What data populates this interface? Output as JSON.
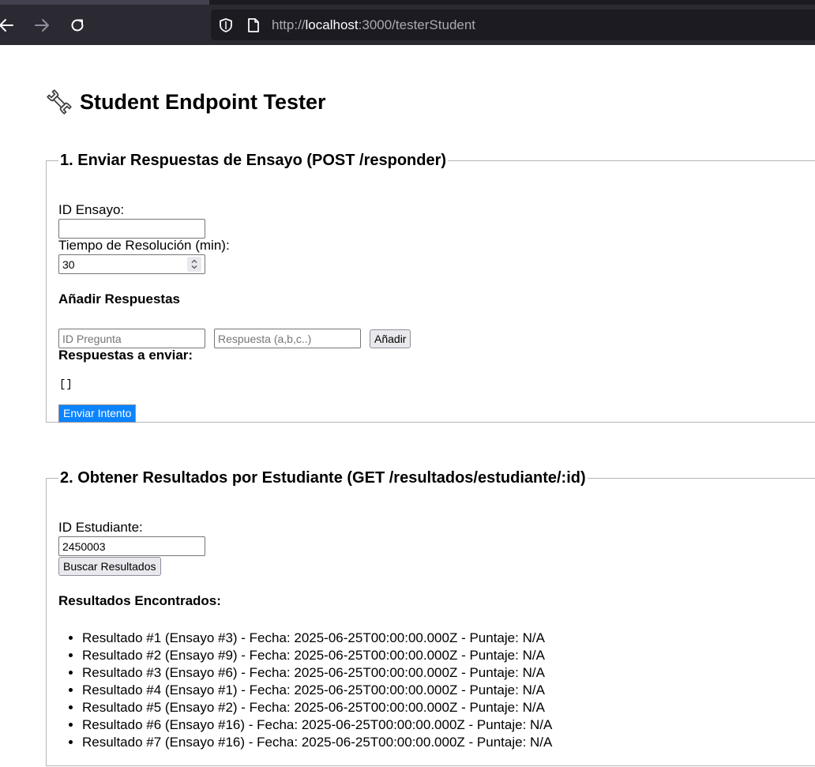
{
  "browser": {
    "url_scheme": "http://",
    "url_host": "localhost",
    "url_rest": ":3000/testerStudent"
  },
  "page": {
    "title": "Student Endpoint Tester"
  },
  "section1": {
    "legend": "1. Enviar Respuestas de Ensayo (POST /responder)",
    "id_ensayo_label": "ID Ensayo:",
    "id_ensayo_value": "",
    "tiempo_label": "Tiempo de Resolución (min):",
    "tiempo_value": "30",
    "add_answers_heading": "Añadir Respuestas",
    "pregunta_placeholder": "ID Pregunta",
    "respuesta_placeholder": "Respuesta (a,b,c..)",
    "add_button": "Añadir",
    "to_send_heading": "Respuestas a enviar:",
    "to_send_json": "[]",
    "submit_button": "Enviar Intento"
  },
  "section2": {
    "legend": "2. Obtener Resultados por Estudiante (GET /resultados/estudiante/:id)",
    "id_estudiante_label": "ID Estudiante:",
    "id_estudiante_value": "2450003",
    "search_button": "Buscar Resultados",
    "results_heading": "Resultados Encontrados:",
    "results": [
      "Resultado #1 (Ensayo #3) - Fecha: 2025-06-25T00:00:00.000Z - Puntaje: N/A",
      "Resultado #2 (Ensayo #9) - Fecha: 2025-06-25T00:00:00.000Z - Puntaje: N/A",
      "Resultado #3 (Ensayo #6) - Fecha: 2025-06-25T00:00:00.000Z - Puntaje: N/A",
      "Resultado #4 (Ensayo #1) - Fecha: 2025-06-25T00:00:00.000Z - Puntaje: N/A",
      "Resultado #5 (Ensayo #2) - Fecha: 2025-06-25T00:00:00.000Z - Puntaje: N/A",
      "Resultado #6 (Ensayo #16) - Fecha: 2025-06-25T00:00:00.000Z - Puntaje: N/A",
      "Resultado #7 (Ensayo #16) - Fecha: 2025-06-25T00:00:00.000Z - Puntaje: N/A"
    ]
  },
  "icons": {
    "title_icon": "wrench-icon",
    "back": "back-arrow-icon",
    "forward": "forward-arrow-icon",
    "reload": "reload-icon",
    "shield": "shield-icon",
    "page": "page-icon"
  },
  "colors": {
    "chrome_bg": "#2b2a33",
    "urlbar_bg": "#1c1b22",
    "primary_button": "#0a84ff"
  }
}
